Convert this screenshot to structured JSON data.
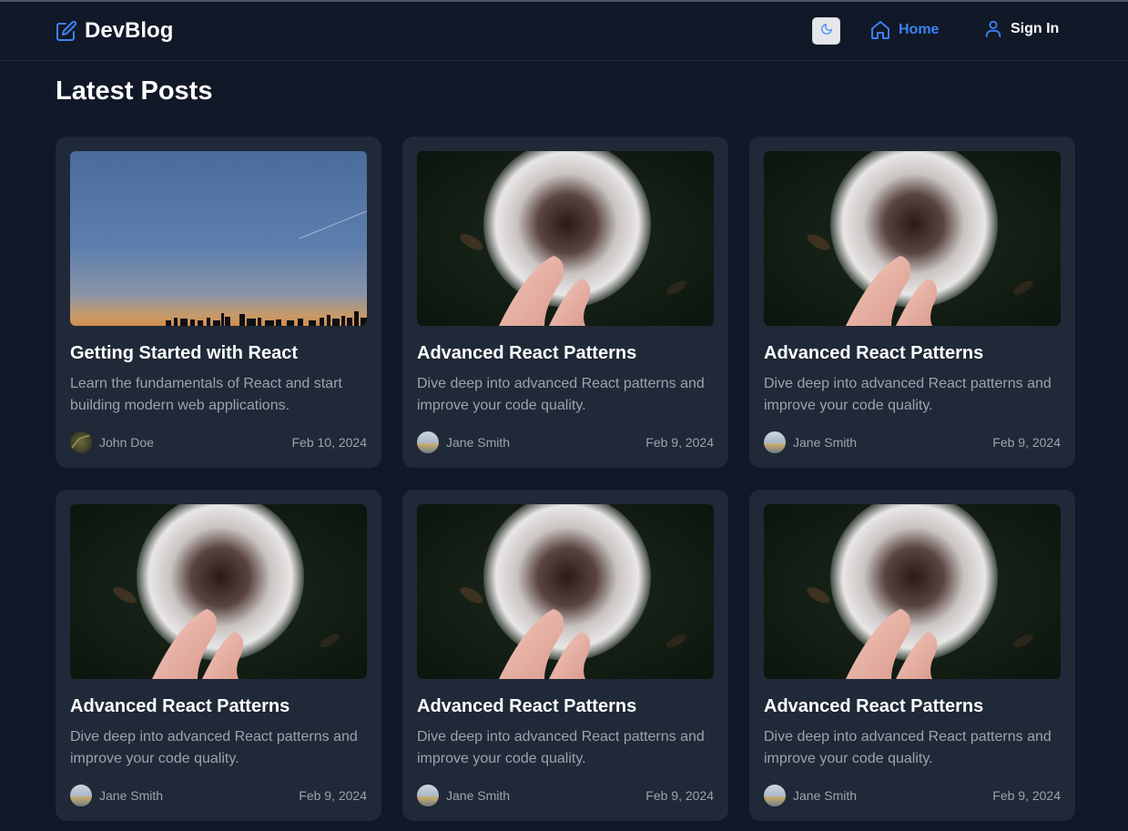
{
  "header": {
    "brand": "DevBlog",
    "brand_icon": "edit-icon",
    "theme_toggle_icon": "moon-icon",
    "nav": [
      {
        "label": "Home",
        "icon": "home-icon",
        "active": true
      },
      {
        "label": "Sign In",
        "icon": "user-icon",
        "active": false
      }
    ],
    "accent_color": "#3b82f6"
  },
  "main": {
    "title": "Latest Posts",
    "posts": [
      {
        "image": "city-skyline-dusk",
        "title": "Getting Started with React",
        "excerpt": "Learn the fundamentals of React and start building modern web applications.",
        "author": "John Doe",
        "date": "Feb 10, 2024"
      },
      {
        "image": "dandelion-in-hand",
        "title": "Advanced React Patterns",
        "excerpt": "Dive deep into advanced React patterns and improve your code quality.",
        "author": "Jane Smith",
        "date": "Feb 9, 2024"
      },
      {
        "image": "dandelion-in-hand",
        "title": "Advanced React Patterns",
        "excerpt": "Dive deep into advanced React patterns and improve your code quality.",
        "author": "Jane Smith",
        "date": "Feb 9, 2024"
      },
      {
        "image": "dandelion-in-hand",
        "title": "Advanced React Patterns",
        "excerpt": "Dive deep into advanced React patterns and improve your code quality.",
        "author": "Jane Smith",
        "date": "Feb 9, 2024"
      },
      {
        "image": "dandelion-in-hand",
        "title": "Advanced React Patterns",
        "excerpt": "Dive deep into advanced React patterns and improve your code quality.",
        "author": "Jane Smith",
        "date": "Feb 9, 2024"
      },
      {
        "image": "dandelion-in-hand",
        "title": "Advanced React Patterns",
        "excerpt": "Dive deep into advanced React patterns and improve your code quality.",
        "author": "Jane Smith",
        "date": "Feb 9, 2024"
      }
    ]
  }
}
